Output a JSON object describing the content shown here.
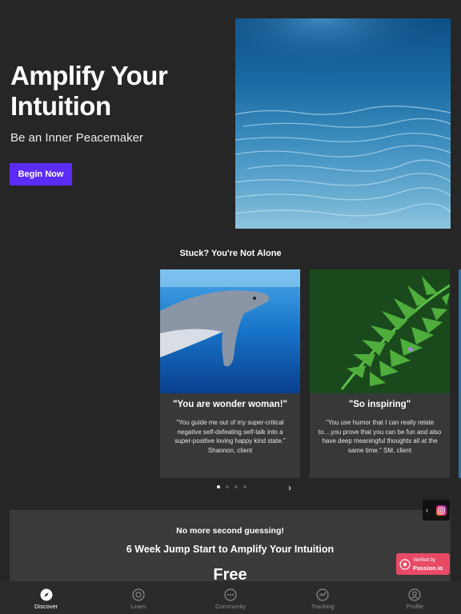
{
  "hero": {
    "title": "Amplify Your Intuition",
    "subtitle": "Be an Inner Peacemaker",
    "button_label": "Begin Now"
  },
  "testimonials": {
    "section_title": "Stuck? You're Not Alone",
    "cards": [
      {
        "title": "\"You are wonder woman!\"",
        "text": "\"You guide me out of my super-critical negative self-defeating self-talk into a super-positive loving happy kind state.\" Shannon, client"
      },
      {
        "title": "\"So inspiring\"",
        "text": "\"You use humor that I can really relate to....you prove that you can be fun and also have deep meaningful thoughts all at the same time.\"  SM, client"
      }
    ],
    "pager_count": 4,
    "pager_active": 0
  },
  "offer": {
    "line1": "No more second guessing!",
    "line2": "6 Week Jump Start to Amplify Your Intuition",
    "price": "Free"
  },
  "badge": {
    "small": "Verified by",
    "brand": "Passion.io"
  },
  "tabbar": {
    "active": "Discover",
    "items": [
      {
        "label": "Discover",
        "icon": "compass-icon"
      },
      {
        "label": "Learn",
        "icon": "learn-icon"
      },
      {
        "label": "Community",
        "icon": "community-icon"
      },
      {
        "label": "Tracking",
        "icon": "tracking-icon"
      },
      {
        "label": "Profile",
        "icon": "profile-icon"
      }
    ]
  },
  "colors": {
    "background": "#262626",
    "accent": "#5b2cf5",
    "card": "#383838",
    "badge": "#e84a66"
  }
}
